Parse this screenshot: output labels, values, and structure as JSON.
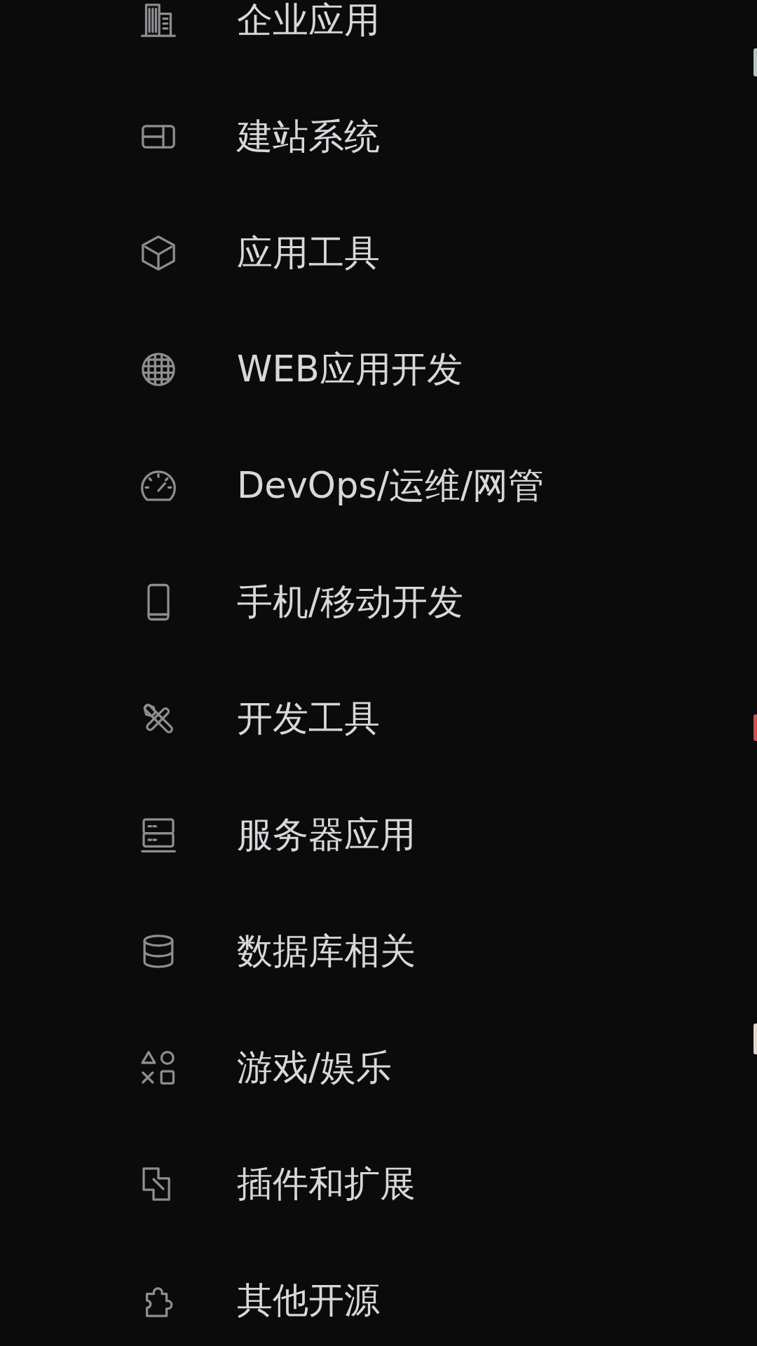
{
  "categories": [
    {
      "label": "企业应用"
    },
    {
      "label": "建站系统"
    },
    {
      "label": "应用工具"
    },
    {
      "label": "WEB应用开发"
    },
    {
      "label": "DevOps/运维/网管"
    },
    {
      "label": "手机/移动开发"
    },
    {
      "label": "开发工具"
    },
    {
      "label": "服务器应用"
    },
    {
      "label": "数据库相关"
    },
    {
      "label": "游戏/娱乐"
    },
    {
      "label": "插件和扩展"
    },
    {
      "label": "其他开源"
    }
  ]
}
